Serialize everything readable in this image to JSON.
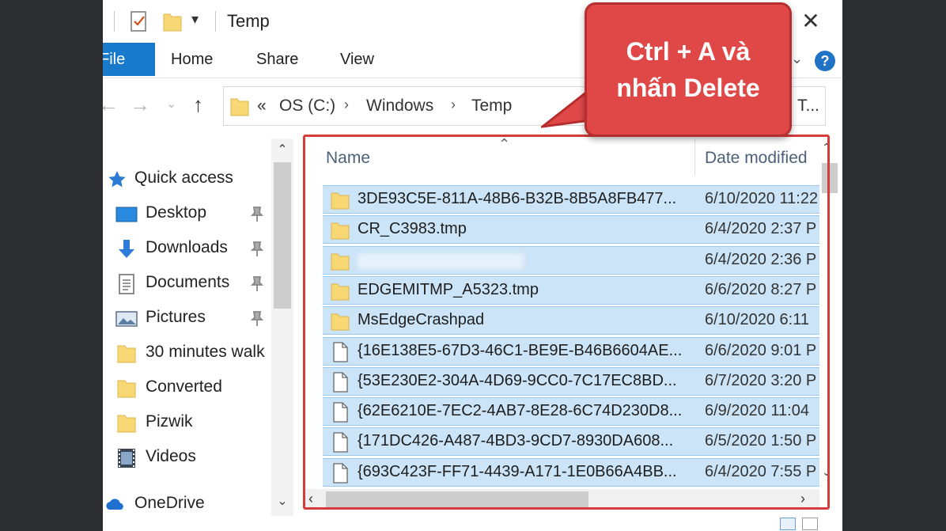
{
  "window": {
    "title": "Temp",
    "close_label": "✕"
  },
  "ribbon": {
    "file_label": "File",
    "tabs": [
      "Home",
      "Share",
      "View"
    ],
    "help_label": "?"
  },
  "address": {
    "overflow": "«",
    "crumbs": [
      "OS (C:)",
      "Windows",
      "Temp"
    ],
    "separator": "›",
    "search_placeholder": "T..."
  },
  "sidebar": {
    "quick_access": "Quick access",
    "items": [
      {
        "label": "Desktop",
        "icon": "desktop-icon",
        "pinned": true
      },
      {
        "label": "Downloads",
        "icon": "downloads-icon",
        "pinned": true
      },
      {
        "label": "Documents",
        "icon": "documents-icon",
        "pinned": true
      },
      {
        "label": "Pictures",
        "icon": "pictures-icon",
        "pinned": true
      },
      {
        "label": "30 minutes walk",
        "icon": "folder-icon",
        "pinned": false
      },
      {
        "label": "Converted",
        "icon": "folder-icon",
        "pinned": false
      },
      {
        "label": "Pizwik",
        "icon": "folder-icon",
        "pinned": false
      },
      {
        "label": "Videos",
        "icon": "videos-icon",
        "pinned": false
      }
    ],
    "onedrive": "OneDrive"
  },
  "filelist": {
    "columns": {
      "name": "Name",
      "date": "Date modified"
    },
    "rows": [
      {
        "name": "3DE93C5E-811A-48B6-B32B-8B5A8FB477...",
        "date": "6/10/2020 11:22",
        "type": "folder"
      },
      {
        "name": "CR_C3983.tmp",
        "date": "6/4/2020 2:37 P",
        "type": "folder"
      },
      {
        "name": "",
        "date": "6/4/2020 2:36 P",
        "type": "folder"
      },
      {
        "name": "EDGEMITMP_A5323.tmp",
        "date": "6/6/2020 8:27 P",
        "type": "folder"
      },
      {
        "name": "MsEdgeCrashpad",
        "date": "6/10/2020 6:11",
        "type": "folder"
      },
      {
        "name": "{16E138E5-67D3-46C1-BE9E-B46B6604AE...",
        "date": "6/6/2020 9:01 P",
        "type": "file"
      },
      {
        "name": "{53E230E2-304A-4D69-9CC0-7C17EC8BD...",
        "date": "6/7/2020 3:20 P",
        "type": "file"
      },
      {
        "name": "{62E6210E-7EC2-4AB7-8E28-6C74D230D8...",
        "date": "6/9/2020 11:04",
        "type": "file"
      },
      {
        "name": "{171DC426-A487-4BD3-9CD7-8930DA608...",
        "date": "6/5/2020 1:50 P",
        "type": "file"
      },
      {
        "name": "{693C423F-FF71-4439-A171-1E0B66A4BB...",
        "date": "6/4/2020 7:55 P",
        "type": "file"
      }
    ]
  },
  "callout": {
    "line1": "Ctrl + A và",
    "line2": "nhấn Delete"
  },
  "colors": {
    "selection": "#cce4f7",
    "accent": "#1979ca",
    "callout": "#e04848",
    "outline": "#d63c3c"
  }
}
